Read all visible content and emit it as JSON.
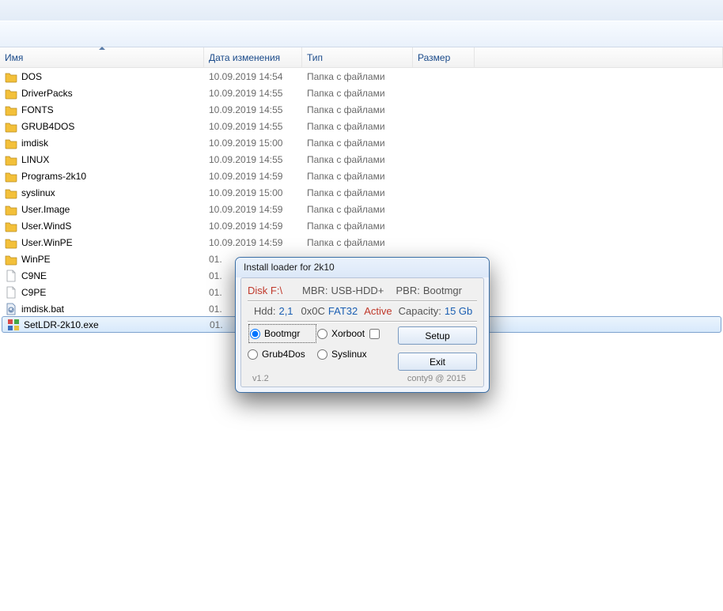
{
  "columns": {
    "name": "Имя",
    "date": "Дата изменения",
    "type": "Тип",
    "size": "Размер"
  },
  "files": [
    {
      "icon": "folder",
      "name": "DOS",
      "date": "10.09.2019 14:54",
      "type": "Папка с файлами"
    },
    {
      "icon": "folder",
      "name": "DriverPacks",
      "date": "10.09.2019 14:55",
      "type": "Папка с файлами"
    },
    {
      "icon": "folder",
      "name": "FONTS",
      "date": "10.09.2019 14:55",
      "type": "Папка с файлами"
    },
    {
      "icon": "folder",
      "name": "GRUB4DOS",
      "date": "10.09.2019 14:55",
      "type": "Папка с файлами"
    },
    {
      "icon": "folder",
      "name": "imdisk",
      "date": "10.09.2019 15:00",
      "type": "Папка с файлами"
    },
    {
      "icon": "folder",
      "name": "LINUX",
      "date": "10.09.2019 14:55",
      "type": "Папка с файлами"
    },
    {
      "icon": "folder",
      "name": "Programs-2k10",
      "date": "10.09.2019 14:59",
      "type": "Папка с файлами"
    },
    {
      "icon": "folder",
      "name": "syslinux",
      "date": "10.09.2019 15:00",
      "type": "Папка с файлами"
    },
    {
      "icon": "folder",
      "name": "User.Image",
      "date": "10.09.2019 14:59",
      "type": "Папка с файлами"
    },
    {
      "icon": "folder",
      "name": "User.WindS",
      "date": "10.09.2019 14:59",
      "type": "Папка с файлами"
    },
    {
      "icon": "folder",
      "name": "User.WinPE",
      "date": "10.09.2019 14:59",
      "type": "Папка с файлами"
    },
    {
      "icon": "folder",
      "name": "WinPE",
      "date": "01.",
      "type": ""
    },
    {
      "icon": "file",
      "name": "C9NE",
      "date": "01.",
      "type": ""
    },
    {
      "icon": "file",
      "name": "C9PE",
      "date": "01.",
      "type": ""
    },
    {
      "icon": "bat",
      "name": "imdisk.bat",
      "date": "01.",
      "type": ""
    },
    {
      "icon": "exe",
      "name": "SetLDR-2k10.exe",
      "date": "01.",
      "type": "",
      "selected": true
    }
  ],
  "dialog": {
    "title": "Install loader for 2k10",
    "disk_label": "Disk F:\\",
    "mbr_label": "MBR:",
    "mbr_value": "USB-HDD+",
    "pbr_label": "PBR:",
    "pbr_value": "Bootmgr",
    "hdd_label": "Hdd:",
    "hdd_value": "2,1",
    "code": "0x0C",
    "fs": "FAT32",
    "status": "Active",
    "capacity_label": "Capacity:",
    "capacity_value": "15 Gb",
    "options": {
      "bootmgr": "Bootmgr",
      "xorboot": "Xorboot",
      "grub4dos": "Grub4Dos",
      "syslinux": "Syslinux"
    },
    "buttons": {
      "setup": "Setup",
      "exit": "Exit"
    },
    "version": "v1.2",
    "credit": "conty9 @ 2015"
  }
}
